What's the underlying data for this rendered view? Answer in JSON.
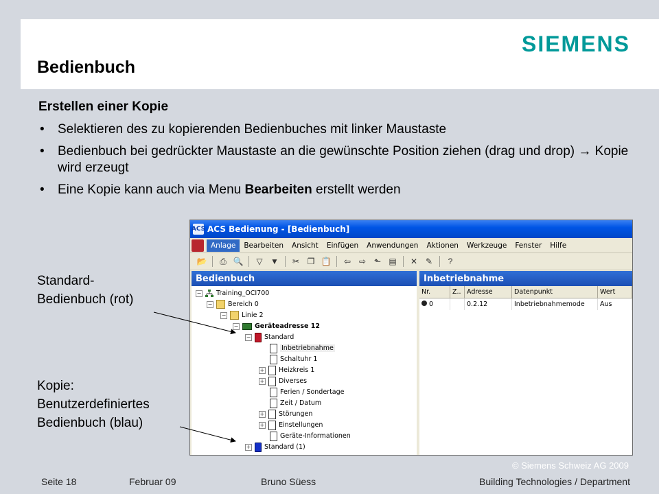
{
  "header": {
    "logo": "SIEMENS",
    "title": "Bedienbuch"
  },
  "content": {
    "subheading": "Erstellen einer Kopie",
    "bullets": [
      "Selektieren des zu kopierenden Bedienbuches mit linker Maustaste",
      "Bedienbuch bei gedrückter Maustaste an die gewünschte Position ziehen (drag und drop) → Kopie wird erzeugt"
    ],
    "bullet3_prefix": "Eine Kopie kann auch via Menu ",
    "bullet3_bold": "Bearbeiten",
    "bullet3_suffix": " erstellt werden",
    "bullet_glyph": "•"
  },
  "callouts": {
    "standard_line1": "Standard-",
    "standard_line2": "Bedienbuch (rot)",
    "kopie_line1": "Kopie:",
    "kopie_line2": "Benutzerdefiniertes",
    "kopie_line3": "Bedienbuch (blau)"
  },
  "app": {
    "window_title": "ACS Bedienung - [Bedienbuch]",
    "menu": [
      "Anlage",
      "Bearbeiten",
      "Ansicht",
      "Einfügen",
      "Anwendungen",
      "Aktionen",
      "Werkzeuge",
      "Fenster",
      "Hilfe"
    ],
    "toolbar_icons": [
      "open-folder-icon",
      "print-icon",
      "print-preview-icon",
      "filter-icon",
      "filter-edit-icon",
      "cut-icon",
      "copy-icon",
      "paste-icon",
      "back-icon",
      "forward-icon",
      "up-folder-icon",
      "properties-icon",
      "delete-icon",
      "edit-icon",
      "help-icon"
    ],
    "left_pane_title": "Bedienbuch",
    "right_pane_title": "Inbetriebnahme",
    "tree": {
      "root": "Training_OCI700",
      "bereich": "Bereich 0",
      "linie": "Linie 2",
      "device": "Geräteadresse 12",
      "standard": "Standard",
      "children": [
        "Inbetriebnahme",
        "Schaltuhr 1",
        "Heizkreis 1",
        "Diverses",
        "Ferien / Sondertage",
        "Zeit / Datum",
        "Störungen",
        "Einstellungen",
        "Geräte-Informationen"
      ],
      "copy": "Standard (1)"
    },
    "table": {
      "headers": [
        "Nr.",
        "Z..",
        "Adresse",
        "Datenpunkt",
        "Wert"
      ],
      "rows": [
        [
          "0",
          "",
          "0.2.12",
          "Inbetriebnahmemode",
          "Aus"
        ]
      ]
    }
  },
  "footer": {
    "page": "Seite 18",
    "date": "Februar 09",
    "author": "Bruno Süess",
    "department": "Building Technologies / Department",
    "copyright": "© Siemens Schweiz AG 2009"
  },
  "colors": {
    "brand": "#009999",
    "titlebar": "#0055e5",
    "pane_header": "#1c4fb4",
    "standard_book": "#c0182b",
    "copy_book": "#1530c8"
  }
}
